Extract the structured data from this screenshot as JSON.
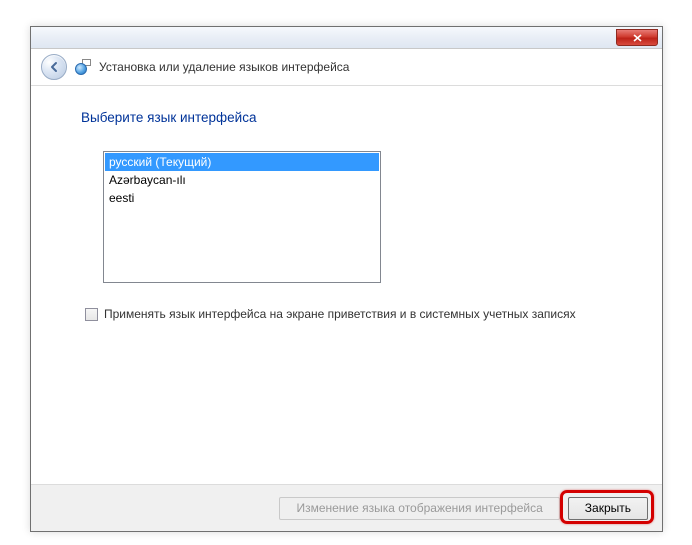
{
  "window": {
    "title": "Установка или удаление языков интерфейса"
  },
  "content": {
    "heading": "Выберите язык интерфейса",
    "languages": [
      "русский (Текущий)",
      "Azərbaycan-ılı",
      "eesti"
    ],
    "apply_checkbox_label": "Применять язык интерфейса на экране приветствия и в системных учетных записях"
  },
  "footer": {
    "change_button": "Изменение языка отображения интерфейса",
    "close_button": "Закрыть"
  }
}
